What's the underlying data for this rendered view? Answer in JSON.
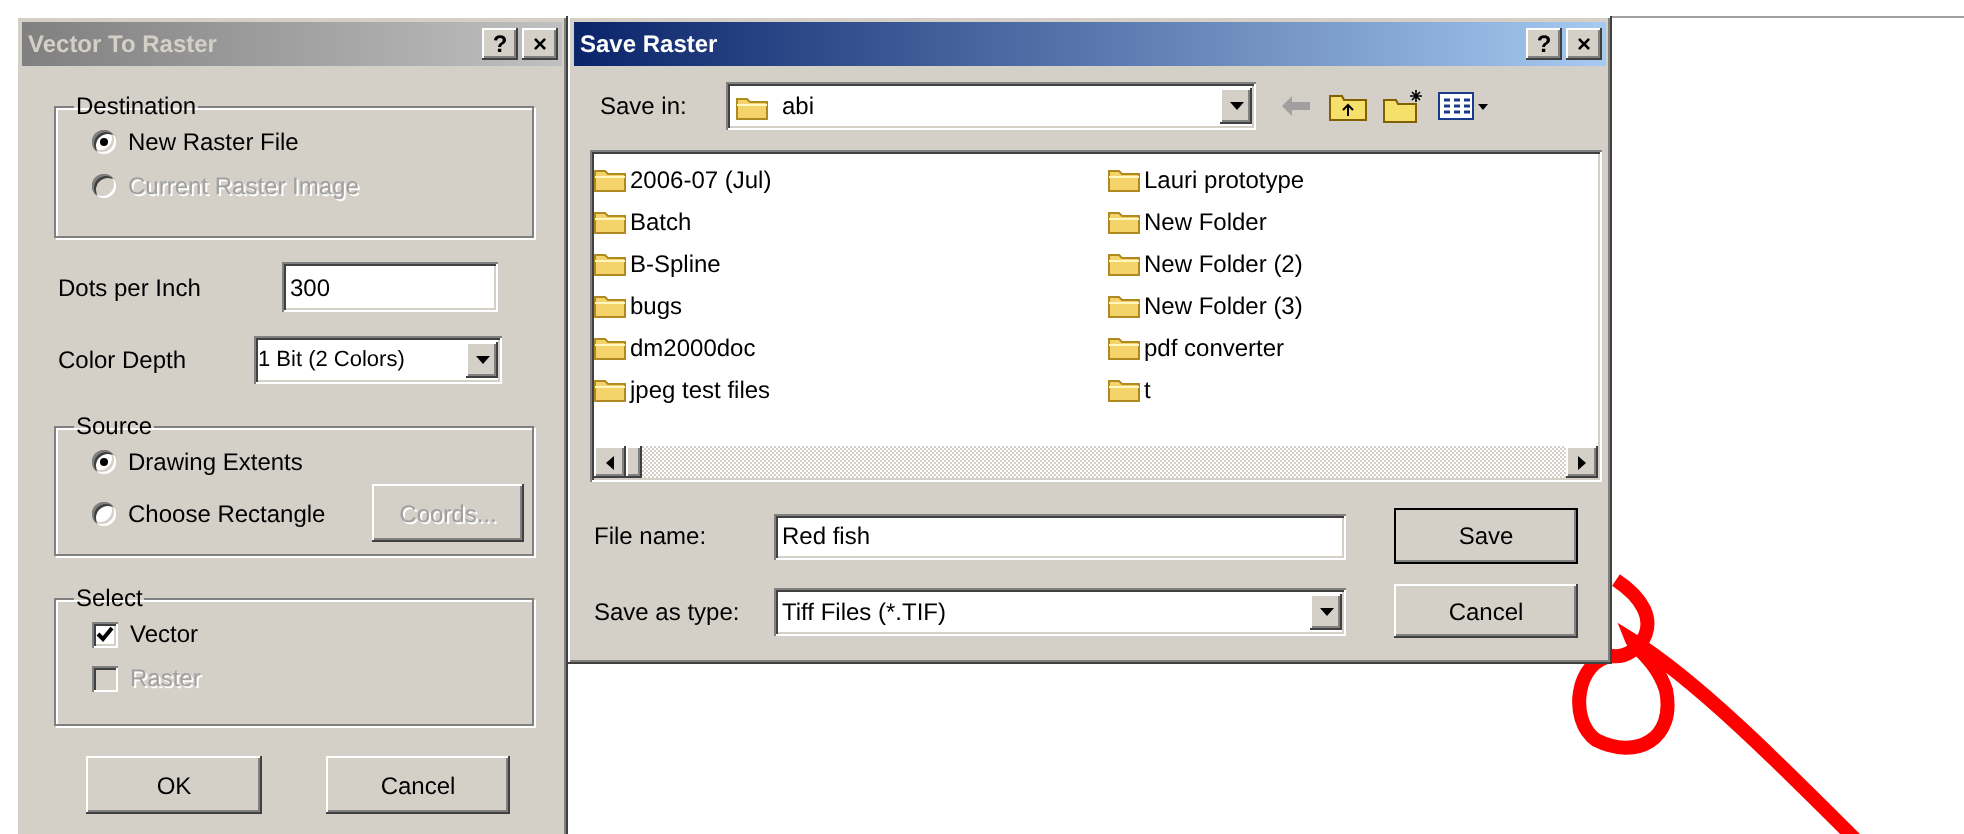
{
  "vector_to_raster": {
    "title": "Vector To Raster",
    "active": false,
    "title_buttons": [
      "?",
      "×"
    ],
    "destination": {
      "label": "Destination",
      "options": [
        {
          "label": "New Raster File",
          "selected": true,
          "disabled": false
        },
        {
          "label": "Current Raster Image",
          "selected": false,
          "disabled": true
        }
      ]
    },
    "dots_per_inch": {
      "label": "Dots per Inch",
      "value": "300"
    },
    "color_depth": {
      "label": "Color Depth",
      "value": "1 Bit (2 Colors)"
    },
    "source": {
      "label": "Source",
      "options": [
        {
          "label": "Drawing Extents",
          "selected": true
        },
        {
          "label": "Choose Rectangle",
          "selected": false
        }
      ],
      "coords_button": {
        "label": "Coords...",
        "disabled": true
      }
    },
    "select": {
      "label": "Select",
      "options": [
        {
          "label": "Vector",
          "checked": true,
          "disabled": false
        },
        {
          "label": "Raster",
          "checked": false,
          "disabled": true
        }
      ]
    },
    "buttons": [
      "OK",
      "Cancel"
    ]
  },
  "save_raster": {
    "title": "Save Raster",
    "active": true,
    "title_buttons": [
      "?",
      "×"
    ],
    "save_in": {
      "label": "Save in:",
      "value": "abi"
    },
    "files": [
      "2006-07 (Jul)",
      "Batch",
      "B-Spline",
      "bugs",
      "dm2000doc",
      "jpeg test files",
      "Lauri prototype",
      "New Folder",
      "New Folder (2)",
      "New Folder (3)",
      "pdf converter",
      "t"
    ],
    "file_name": {
      "label": "File name:",
      "value": "Red fish"
    },
    "save_as_type": {
      "label": "Save as type:",
      "value": "Tiff Files (*.TIF)"
    },
    "buttons": [
      {
        "label": "Save",
        "default": true
      },
      {
        "label": "Cancel",
        "default": false
      }
    ]
  }
}
